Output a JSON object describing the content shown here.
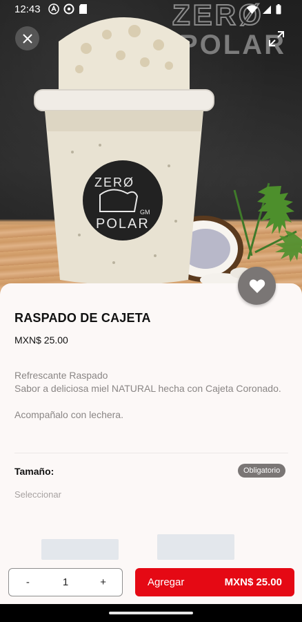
{
  "status_bar": {
    "time": "12:43",
    "left_icons": [
      "navigation-a-icon",
      "settings-gear-icon",
      "sd-card-icon"
    ],
    "right_icons": [
      "wifi-icon",
      "signal-icon",
      "battery-icon"
    ]
  },
  "hero": {
    "image": "raspado-cup-with-coconut",
    "logo_text_line1": "ZERØ",
    "logo_text_line2": "POLAR",
    "logo_sub": "GM",
    "close_icon": "close-icon",
    "expand_icon": "expand-icon"
  },
  "product": {
    "title": "RASPADO DE CAJETA",
    "price": "MXN$ 25.00",
    "description": [
      "Refrescante Raspado",
      "Sabor a deliciosa miel NATURAL hecha con Cajeta Coronado.",
      "",
      "Acompañalo con lechera."
    ],
    "favorite_icon": "heart-icon"
  },
  "options": {
    "label": "Tamaño:",
    "badge": "Obligatorio",
    "placeholder": "Seleccionar"
  },
  "cart": {
    "minus": "-",
    "quantity": "1",
    "plus": "+",
    "add_label": "Agregar",
    "add_amount": "MXN$ 25.00"
  },
  "colors": {
    "accent": "#e50914",
    "sheet_bg": "#fcf8f7",
    "badge_bg": "#7a7675"
  }
}
